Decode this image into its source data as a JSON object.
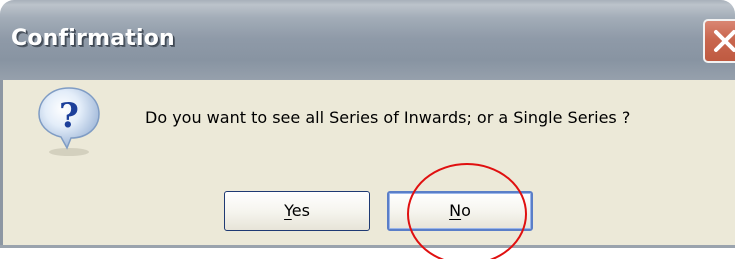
{
  "window": {
    "title": "Confirmation",
    "close_icon": "close-icon"
  },
  "message": {
    "icon": "question-icon",
    "text": "Do you want to see all Series of Inwards; or a Single Series ?"
  },
  "buttons": {
    "yes": {
      "mnemonic": "Y",
      "rest": "es"
    },
    "no": {
      "mnemonic": "N",
      "rest": "o"
    }
  },
  "colors": {
    "dialog_background": "#ece9d8",
    "titlebar": "#8f9aa8",
    "close_button": "#c9674f",
    "annotation_circle": "#e01010"
  }
}
